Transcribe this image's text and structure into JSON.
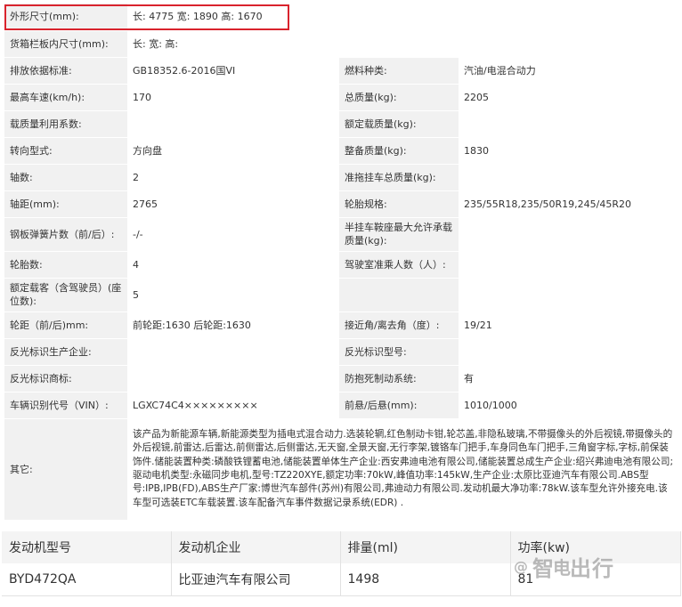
{
  "spec": {
    "dimensions_label": "外形尺寸(mm):",
    "dimensions_value": "长: 4775 宽: 1890 高: 1670",
    "cargo_label": "货箱栏板内尺寸(mm):",
    "cargo_value": "长: 宽: 高:",
    "rows": [
      {
        "k1": "排放依据标准:",
        "v1": "GB18352.6-2016国VI",
        "k2": "燃料种类:",
        "v2": "汽油/电混合动力"
      },
      {
        "k1": "最高车速(km/h):",
        "v1": "170",
        "k2": "总质量(kg):",
        "v2": "2205"
      },
      {
        "k1": "载质量利用系数:",
        "v1": "",
        "k2": "额定载质量(kg):",
        "v2": ""
      },
      {
        "k1": "转向型式:",
        "v1": "方向盘",
        "k2": "整备质量(kg):",
        "v2": "1830"
      },
      {
        "k1": "轴数:",
        "v1": "2",
        "k2": "准拖挂车总质量(kg):",
        "v2": ""
      },
      {
        "k1": "轴距(mm):",
        "v1": "2765",
        "k2": "轮胎规格:",
        "v2": "235/55R18,235/50R19,245/45R20"
      },
      {
        "k1": "钢板弹簧片数（前/后）:",
        "v1": "-/-",
        "k2": "半挂车鞍座最大允许承载质量(kg):",
        "v2": ""
      },
      {
        "k1": "轮胎数:",
        "v1": "4",
        "k2": "驾驶室准乘人数（人）:",
        "v2": ""
      },
      {
        "k1": "额定载客（含驾驶员）(座位数):",
        "v1": "5",
        "k2": "",
        "v2": ""
      },
      {
        "k1": "轮距（前/后)mm:",
        "v1": "前轮距:1630 后轮距:1630",
        "k2": "接近角/离去角（度）:",
        "v2": "19/21"
      },
      {
        "k1": "反光标识生产企业:",
        "v1": "",
        "k2": "反光标识型号:",
        "v2": ""
      },
      {
        "k1": "反光标识商标:",
        "v1": "",
        "k2": "防抱死制动系统:",
        "v2": "有"
      },
      {
        "k1": "车辆识别代号（VIN）:",
        "v1": "LGXC74C4×××××××××",
        "k2": "前悬/后悬(mm):",
        "v2": "1010/1000"
      }
    ],
    "other_label": "其它:",
    "other_value": "该产品为新能源车辆,新能源类型为插电式混合动力.选装轮辋,红色制动卡钳,轮芯盖,非隐私玻璃,不带摄像头的外后视镜,带摄像头的外后视镜,前雷达,后雷达,前侧雷达,后侧雷达,无天窗,全景天窗,无行李架,镀铬车门把手,车身同色车门把手,三角窗字标,字标,前保装饰件.储能装置种类:磷酸铁锂蓄电池,储能装置单体生产企业:西安弗迪电池有限公司,储能装置总成生产企业:绍兴弗迪电池有限公司;驱动电机类型:永磁同步电机,型号:TZ220XYE,额定功率:70kW,峰值功率:145kW,生产企业:太原比亚迪汽车有限公司.ABS型号:IPB,IPB(FD),ABS生产厂家:博世汽车部件(苏州)有限公司,弗迪动力有限公司.发动机最大净功率:78kW.该车型允许外接充电.该车型可选装ETC车载装置.该车配备汽车事件数据记录系统(EDR) ."
  },
  "engine": {
    "headers": [
      "发动机型号",
      "发动机企业",
      "排量(ml)",
      "功率(kw)"
    ],
    "row": [
      "BYD472QA",
      "比亚迪汽车有限公司",
      "1498",
      "81"
    ]
  },
  "watermark": {
    "icon": "weibo-icon",
    "text_a": "智",
    "text_b": "出行",
    "bolt": "电"
  },
  "colors": {
    "highlight": "#d9232d",
    "key_bg": "#f1f1f1"
  }
}
